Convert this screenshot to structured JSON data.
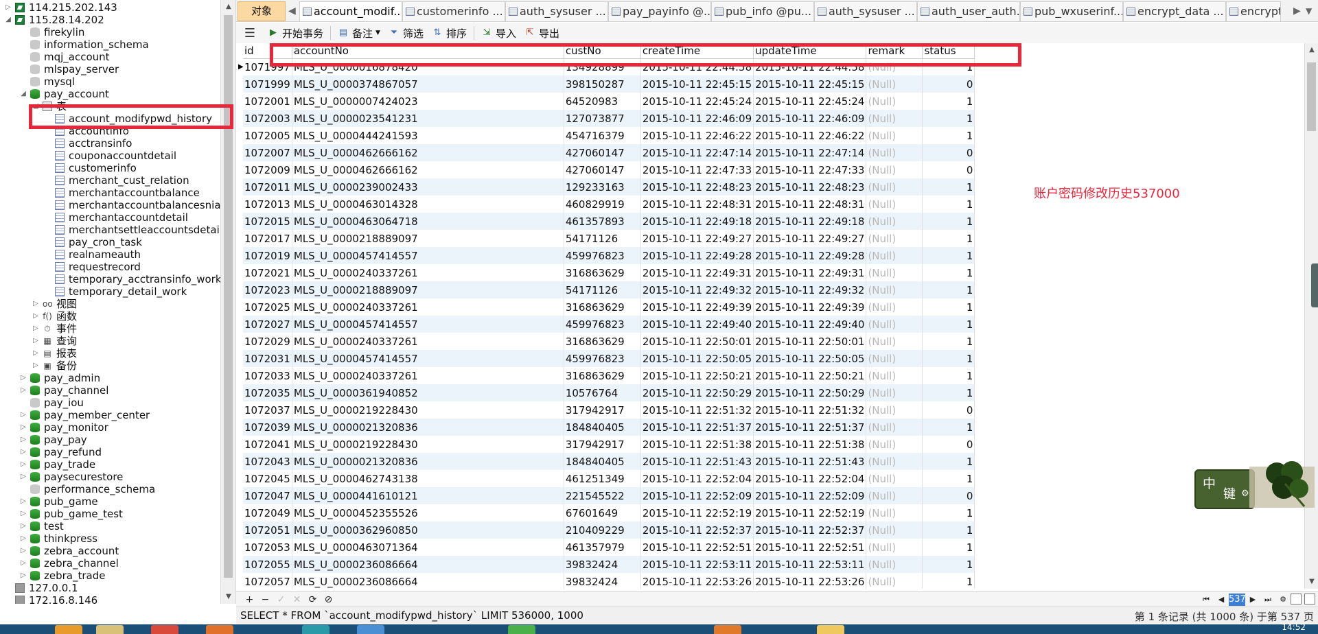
{
  "nav": {
    "items": [
      {
        "label": "114.215.202.143",
        "level": 0,
        "icon": "connection",
        "expanded": false
      },
      {
        "label": "115.28.14.202",
        "level": 0,
        "icon": "connection",
        "expanded": true
      },
      {
        "label": "firekylin",
        "level": 1,
        "icon": "database-off"
      },
      {
        "label": "information_schema",
        "level": 1,
        "icon": "database-off"
      },
      {
        "label": "mqj_account",
        "level": 1,
        "icon": "database-off"
      },
      {
        "label": "mlspay_server",
        "level": 1,
        "icon": "database-off"
      },
      {
        "label": "mysql",
        "level": 1,
        "icon": "database-off"
      },
      {
        "label": "pay_account",
        "level": 1,
        "icon": "database",
        "expanded": true
      },
      {
        "label": "表",
        "level": 2,
        "icon": "folder",
        "expanded": true
      },
      {
        "label": "account_modifypwd_history",
        "level": 3,
        "icon": "table",
        "selected": true
      },
      {
        "label": "accountinfo",
        "level": 3,
        "icon": "table"
      },
      {
        "label": "acctransinfo",
        "level": 3,
        "icon": "table"
      },
      {
        "label": "couponaccountdetail",
        "level": 3,
        "icon": "table"
      },
      {
        "label": "customerinfo",
        "level": 3,
        "icon": "table"
      },
      {
        "label": "merchant_cust_relation",
        "level": 3,
        "icon": "table"
      },
      {
        "label": "merchantaccountbalance",
        "level": 3,
        "icon": "table"
      },
      {
        "label": "merchantaccountbalancesnia",
        "level": 3,
        "icon": "table"
      },
      {
        "label": "merchantaccountdetail",
        "level": 3,
        "icon": "table"
      },
      {
        "label": "merchantsettleaccountsdetail",
        "level": 3,
        "icon": "table"
      },
      {
        "label": "pay_cron_task",
        "level": 3,
        "icon": "table"
      },
      {
        "label": "realnameauth",
        "level": 3,
        "icon": "table"
      },
      {
        "label": "requestrecord",
        "level": 3,
        "icon": "table"
      },
      {
        "label": "temporary_acctransinfo_work",
        "level": 3,
        "icon": "table"
      },
      {
        "label": "temporary_detail_work",
        "level": 3,
        "icon": "table"
      },
      {
        "label": "视图",
        "level": 2,
        "icon": "view",
        "expanded": false
      },
      {
        "label": "函数",
        "level": 2,
        "icon": "function",
        "expanded": false
      },
      {
        "label": "事件",
        "level": 2,
        "icon": "event",
        "expanded": false
      },
      {
        "label": "查询",
        "level": 2,
        "icon": "query",
        "expanded": false
      },
      {
        "label": "报表",
        "level": 2,
        "icon": "report",
        "expanded": false
      },
      {
        "label": "备份",
        "level": 2,
        "icon": "backup",
        "expanded": false
      },
      {
        "label": "pay_admin",
        "level": 1,
        "icon": "database",
        "expanded": false
      },
      {
        "label": "pay_channel",
        "level": 1,
        "icon": "database",
        "expanded": false
      },
      {
        "label": "pay_iou",
        "level": 1,
        "icon": "database-off"
      },
      {
        "label": "pay_member_center",
        "level": 1,
        "icon": "database",
        "expanded": false
      },
      {
        "label": "pay_monitor",
        "level": 1,
        "icon": "database",
        "expanded": false
      },
      {
        "label": "pay_pay",
        "level": 1,
        "icon": "database",
        "expanded": false
      },
      {
        "label": "pay_refund",
        "level": 1,
        "icon": "database",
        "expanded": false
      },
      {
        "label": "pay_trade",
        "level": 1,
        "icon": "database",
        "expanded": false
      },
      {
        "label": "paysecurestore",
        "level": 1,
        "icon": "database",
        "expanded": false
      },
      {
        "label": "performance_schema",
        "level": 1,
        "icon": "database-off"
      },
      {
        "label": "pub_game",
        "level": 1,
        "icon": "database",
        "expanded": false
      },
      {
        "label": "pub_game_test",
        "level": 1,
        "icon": "database",
        "expanded": false
      },
      {
        "label": "test",
        "level": 1,
        "icon": "database",
        "expanded": false
      },
      {
        "label": "thinkpress",
        "level": 1,
        "icon": "database",
        "expanded": false
      },
      {
        "label": "zebra_account",
        "level": 1,
        "icon": "database",
        "expanded": false
      },
      {
        "label": "zebra_channel",
        "level": 1,
        "icon": "database",
        "expanded": false
      },
      {
        "label": "zebra_trade",
        "level": 1,
        "icon": "database",
        "expanded": false
      },
      {
        "label": "127.0.0.1",
        "level": 0,
        "icon": "connection-off"
      },
      {
        "label": "172.16.8.146",
        "level": 0,
        "icon": "connection-off"
      }
    ]
  },
  "tabs": {
    "objects_label": "对象",
    "items": [
      {
        "label": "account_modif...",
        "active": true
      },
      {
        "label": "customerinfo ...",
        "active": false
      },
      {
        "label": "auth_sysuser ...",
        "active": false
      },
      {
        "label": "pay_payinfo @...",
        "active": false
      },
      {
        "label": "pub_info @pu...",
        "active": false
      },
      {
        "label": "auth_sysuser ...",
        "active": false
      },
      {
        "label": "auth_user_auth...",
        "active": false
      },
      {
        "label": "pub_wxuserinf...",
        "active": false
      },
      {
        "label": "encrypt_data ...",
        "active": false
      },
      {
        "label": "encrypti",
        "active": false
      }
    ]
  },
  "toolbar": {
    "begin_transaction": "开始事务",
    "memo": "备注",
    "filter": "筛选",
    "sort": "排序",
    "import": "导入",
    "export": "导出"
  },
  "grid": {
    "columns": [
      "id",
      "accountNo",
      "custNo",
      "createTime",
      "updateTime",
      "remark",
      "status"
    ],
    "rows": [
      [
        "1071997",
        "MLS_U_0000016878420",
        "134928899",
        "2015-10-11 22:44:58",
        "2015-10-11 22:44:58",
        "(Null)",
        "1"
      ],
      [
        "1071999",
        "MLS_U_0000374867057",
        "398150287",
        "2015-10-11 22:45:15",
        "2015-10-11 22:45:15",
        "(Null)",
        "0"
      ],
      [
        "1072001",
        "MLS_U_0000007424023",
        "64520983",
        "2015-10-11 22:45:24",
        "2015-10-11 22:45:24",
        "(Null)",
        "1"
      ],
      [
        "1072003",
        "MLS_U_0000023541231",
        "127073877",
        "2015-10-11 22:46:09",
        "2015-10-11 22:46:09",
        "(Null)",
        "1"
      ],
      [
        "1072005",
        "MLS_U_0000444241593",
        "454716379",
        "2015-10-11 22:46:22",
        "2015-10-11 22:46:22",
        "(Null)",
        "1"
      ],
      [
        "1072007",
        "MLS_U_0000462666162",
        "427060147",
        "2015-10-11 22:47:14",
        "2015-10-11 22:47:14",
        "(Null)",
        "0"
      ],
      [
        "1072009",
        "MLS_U_0000462666162",
        "427060147",
        "2015-10-11 22:47:33",
        "2015-10-11 22:47:33",
        "(Null)",
        "0"
      ],
      [
        "1072011",
        "MLS_U_0000239002433",
        "129233163",
        "2015-10-11 22:48:23",
        "2015-10-11 22:48:23",
        "(Null)",
        "1"
      ],
      [
        "1072013",
        "MLS_U_0000463014328",
        "460829919",
        "2015-10-11 22:48:31",
        "2015-10-11 22:48:31",
        "(Null)",
        "1"
      ],
      [
        "1072015",
        "MLS_U_0000463064718",
        "461357893",
        "2015-10-11 22:49:18",
        "2015-10-11 22:49:18",
        "(Null)",
        "1"
      ],
      [
        "1072017",
        "MLS_U_0000218889097",
        "54171126",
        "2015-10-11 22:49:27",
        "2015-10-11 22:49:27",
        "(Null)",
        "1"
      ],
      [
        "1072019",
        "MLS_U_0000457414557",
        "459976823",
        "2015-10-11 22:49:28",
        "2015-10-11 22:49:28",
        "(Null)",
        "1"
      ],
      [
        "1072021",
        "MLS_U_0000240337261",
        "316863629",
        "2015-10-11 22:49:31",
        "2015-10-11 22:49:31",
        "(Null)",
        "1"
      ],
      [
        "1072023",
        "MLS_U_0000218889097",
        "54171126",
        "2015-10-11 22:49:32",
        "2015-10-11 22:49:32",
        "(Null)",
        "1"
      ],
      [
        "1072025",
        "MLS_U_0000240337261",
        "316863629",
        "2015-10-11 22:49:39",
        "2015-10-11 22:49:39",
        "(Null)",
        "1"
      ],
      [
        "1072027",
        "MLS_U_0000457414557",
        "459976823",
        "2015-10-11 22:49:40",
        "2015-10-11 22:49:40",
        "(Null)",
        "1"
      ],
      [
        "1072029",
        "MLS_U_0000240337261",
        "316863629",
        "2015-10-11 22:50:01",
        "2015-10-11 22:50:01",
        "(Null)",
        "1"
      ],
      [
        "1072031",
        "MLS_U_0000457414557",
        "459976823",
        "2015-10-11 22:50:05",
        "2015-10-11 22:50:05",
        "(Null)",
        "1"
      ],
      [
        "1072033",
        "MLS_U_0000240337261",
        "316863629",
        "2015-10-11 22:50:21",
        "2015-10-11 22:50:21",
        "(Null)",
        "1"
      ],
      [
        "1072035",
        "MLS_U_0000361940852",
        "10576764",
        "2015-10-11 22:50:29",
        "2015-10-11 22:50:29",
        "(Null)",
        "1"
      ],
      [
        "1072037",
        "MLS_U_0000219228430",
        "317942917",
        "2015-10-11 22:51:32",
        "2015-10-11 22:51:32",
        "(Null)",
        "0"
      ],
      [
        "1072039",
        "MLS_U_0000021320836",
        "184840405",
        "2015-10-11 22:51:37",
        "2015-10-11 22:51:37",
        "(Null)",
        "1"
      ],
      [
        "1072041",
        "MLS_U_0000219228430",
        "317942917",
        "2015-10-11 22:51:38",
        "2015-10-11 22:51:38",
        "(Null)",
        "0"
      ],
      [
        "1072043",
        "MLS_U_0000021320836",
        "184840405",
        "2015-10-11 22:51:43",
        "2015-10-11 22:51:43",
        "(Null)",
        "1"
      ],
      [
        "1072045",
        "MLS_U_0000462743138",
        "461251349",
        "2015-10-11 22:52:04",
        "2015-10-11 22:52:04",
        "(Null)",
        "1"
      ],
      [
        "1072047",
        "MLS_U_0000441610121",
        "221545522",
        "2015-10-11 22:52:09",
        "2015-10-11 22:52:09",
        "(Null)",
        "0"
      ],
      [
        "1072049",
        "MLS_U_0000452355526",
        "67601649",
        "2015-10-11 22:52:19",
        "2015-10-11 22:52:19",
        "(Null)",
        "1"
      ],
      [
        "1072051",
        "MLS_U_0000362960850",
        "210409229",
        "2015-10-11 22:52:37",
        "2015-10-11 22:52:37",
        "(Null)",
        "1"
      ],
      [
        "1072053",
        "MLS_U_0000463071364",
        "461357979",
        "2015-10-11 22:52:51",
        "2015-10-11 22:52:51",
        "(Null)",
        "1"
      ],
      [
        "1072055",
        "MLS_U_0000236086664",
        "39832424",
        "2015-10-11 22:53:11",
        "2015-10-11 22:53:11",
        "(Null)",
        "1"
      ],
      [
        "1072057",
        "MLS_U_0000236086664",
        "39832424",
        "2015-10-11 22:53:26",
        "2015-10-11 22:53:26",
        "(Null)",
        "1"
      ]
    ]
  },
  "annotation": "账户密码修改历史537000",
  "ime": {
    "mode": "中",
    "key": "键",
    "gear": "⚙"
  },
  "pager": {
    "page": "537"
  },
  "status": {
    "sql": "SELECT * FROM `account_modifypwd_history` LIMIT 536000, 1000",
    "record": "第 1 条记录 (共 1000 条) 于第 537 页"
  },
  "taskbar": {
    "clock": "14:52"
  },
  "colors": {
    "highlight": "#e8273a",
    "objects_tab": "#fcd8a2",
    "odd_row": "#ecf4fb",
    "null_text": "#b8b8b8"
  }
}
